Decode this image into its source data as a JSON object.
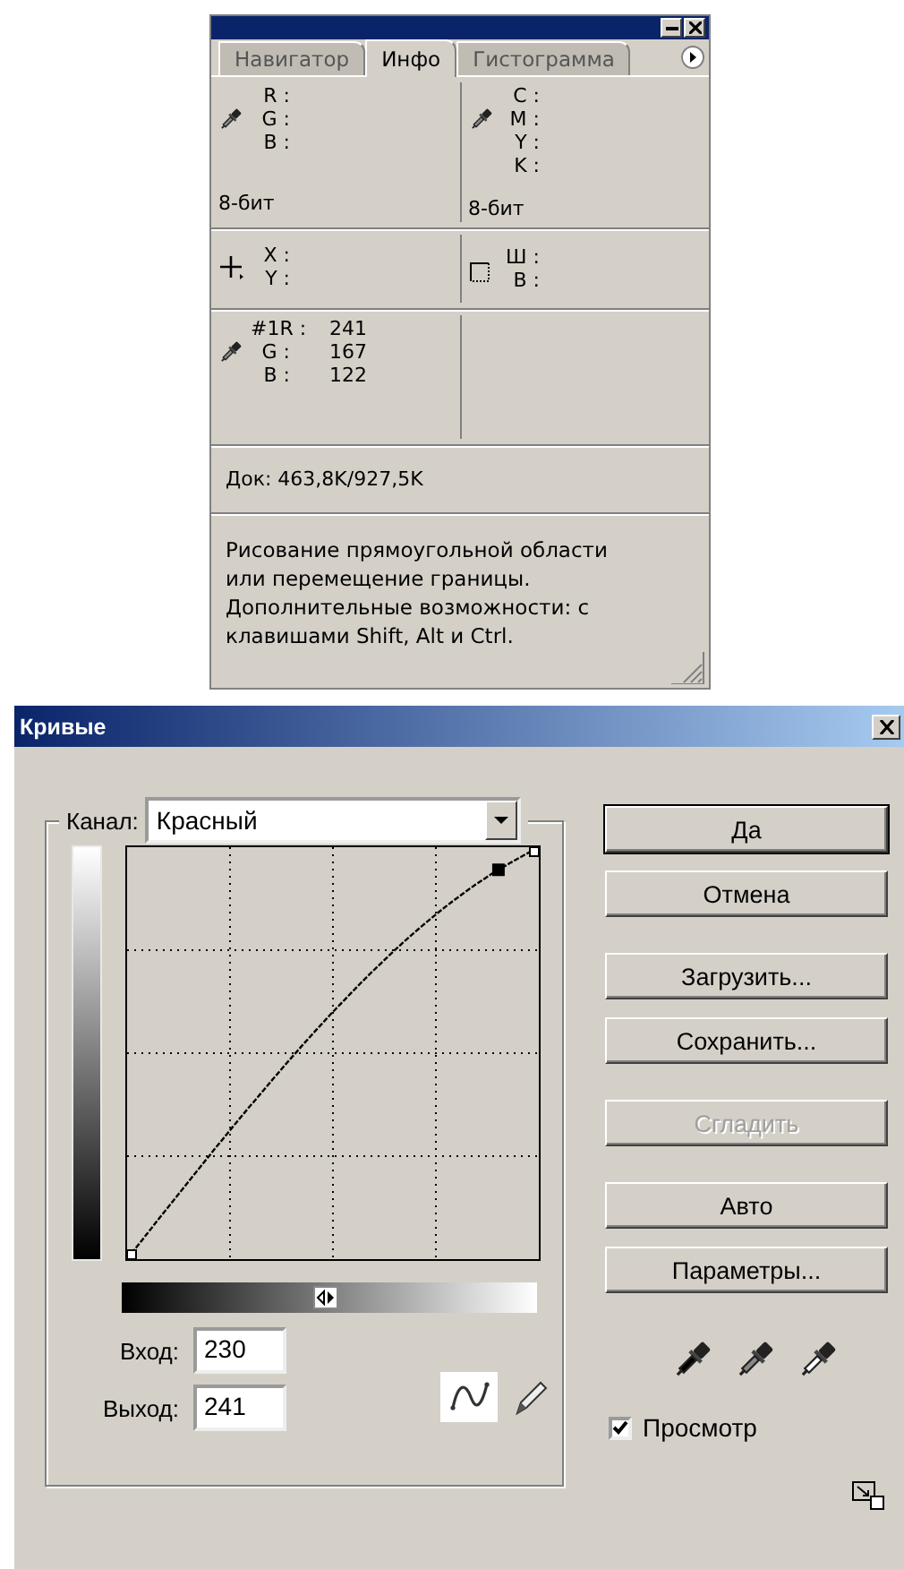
{
  "palette": {
    "tabs": [
      {
        "label": "Навигатор",
        "selected": false
      },
      {
        "label": "Инфо",
        "selected": true
      },
      {
        "label": "Гистограмма",
        "selected": false
      }
    ],
    "rgb_readout": {
      "labels": [
        "R :",
        "G :",
        "B :"
      ],
      "bit_depth": "8-бит"
    },
    "cmyk_readout": {
      "labels": [
        "C :",
        "M :",
        "Y :",
        "K :"
      ],
      "bit_depth": "8-бит"
    },
    "position_readout": {
      "labels": [
        "X :",
        "Y :"
      ]
    },
    "size_readout": {
      "labels": [
        "Ш :",
        "В :"
      ]
    },
    "sampler": {
      "index": "#1",
      "rows": [
        {
          "label": "R :",
          "value": "241"
        },
        {
          "label": "G :",
          "value": "167"
        },
        {
          "label": "B :",
          "value": "122"
        }
      ]
    },
    "document": "Док: 463,8K/927,5K",
    "hint": "Рисование прямоугольной области\nили перемещение границы.\nДополнительные возможности: с\nклавишами Shift, Alt и Ctrl."
  },
  "curves": {
    "title": "Кривые",
    "channel": {
      "label": "Канал:",
      "value": "Красный"
    },
    "input": {
      "label": "Вход:",
      "value": "230"
    },
    "output": {
      "label": "Выход:",
      "value": "241"
    },
    "tools": [
      {
        "kind": "curve",
        "selected": true
      },
      {
        "kind": "pencil",
        "selected": false
      }
    ],
    "buttons": [
      {
        "label": "Да",
        "default": true,
        "disabled": false
      },
      {
        "label": "Отмена",
        "default": false,
        "disabled": false
      },
      {
        "label": "Загрузить...",
        "default": false,
        "disabled": false
      },
      {
        "label": "Сохранить...",
        "default": false,
        "disabled": false
      },
      {
        "label": "Сгладить",
        "default": false,
        "disabled": true
      },
      {
        "label": "Авто",
        "default": false,
        "disabled": false
      },
      {
        "label": "Параметры...",
        "default": false,
        "disabled": false
      }
    ],
    "preview": {
      "label": "Просмотр",
      "checked": true
    }
  }
}
